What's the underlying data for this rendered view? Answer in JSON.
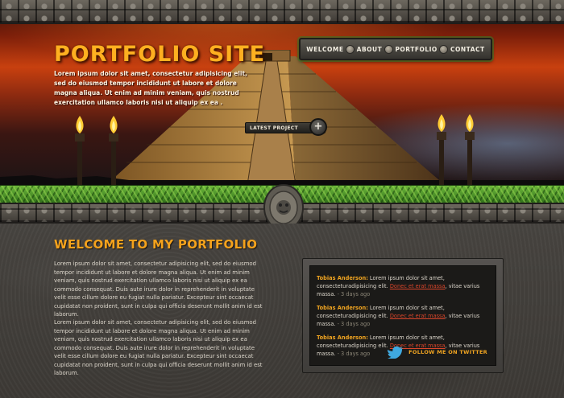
{
  "hero": {
    "title": "PORTFOLIO SITE",
    "intro": "Lorem ipsum dolor sit amet, consectetur adipisicing elit, sed do eiusmod tempor incididunt ut labore et dolore magna aliqua. Ut enim ad minim veniam, quis nostrud exercitation ullamco laboris nisi ut aliquip ex ea .",
    "latest_project_label": "LATEST PROJECT",
    "latest_project_plus": "+"
  },
  "nav": {
    "items": [
      {
        "label": "WELCOME"
      },
      {
        "label": "ABOUT"
      },
      {
        "label": "PORTFOLIO"
      },
      {
        "label": "CONTACT"
      }
    ]
  },
  "main": {
    "heading": "WELCOME TO MY PORTFOLIO",
    "paragraphs": [
      "Lorem ipsum dolor sit amet, consectetur adipisicing elit, sed do eiusmod tempor incididunt ut labore et dolore magna aliqua. Ut enim ad minim veniam, quis nostrud exercitation ullamco laboris nisi ut aliquip ex ea commodo consequat. Duis aute irure dolor in reprehenderit in voluptate velit esse cillum dolore eu fugiat nulla pariatur. Excepteur sint occaecat cupidatat non proident, sunt in culpa qui officia deserunt mollit anim id est laborum.",
      "Lorem ipsum dolor sit amet, consectetur adipisicing elit, sed do eiusmod tempor incididunt ut labore et dolore magna aliqua. Ut enim ad minim veniam, quis nostrud exercitation ullamco laboris nisi ut aliquip ex ea commodo consequat. Duis aute irure dolor in reprehenderit in voluptate velit esse cillum dolore eu fugiat nulla pariatur. Excepteur sint occaecat cupidatat non proident, sunt in culpa qui officia deserunt mollit anim id est laborum."
    ]
  },
  "twitter": {
    "tweets": [
      {
        "name": "Tobias Anderson:",
        "text": " Lorem ipsum dolor sit amet, consecteturadipisicing elit. ",
        "link": "Donec et erat massa",
        "tail": ", vitae varius massa.",
        "ago": " - 3 days ago"
      },
      {
        "name": "Tobias Anderson:",
        "text": " Lorem ipsum dolor sit amet, consecteturadipisicing elit. ",
        "link": "Donec et erat massa",
        "tail": ", vitae varius massa.",
        "ago": " - 3 days ago"
      },
      {
        "name": "Tobias Anderson:",
        "text": " Lorem ipsum dolor sit amet, consecteturadipisicing elit. ",
        "link": "Donec et erat massa",
        "tail": ", vitae varius massa.",
        "ago": " - 3 days ago"
      }
    ],
    "follow_label": "FOLLOW ME ON TWITTER",
    "follow_icon": "twitter-bird-icon"
  },
  "colors": {
    "accent": "#f4a21c",
    "link": "#d9452a",
    "grass": "#3f8a23",
    "twitter_bird": "#3fa9e0"
  }
}
